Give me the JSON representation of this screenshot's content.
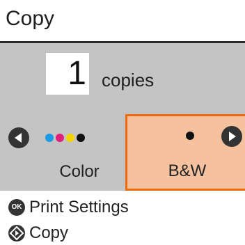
{
  "header": {
    "title": "Copy"
  },
  "copies": {
    "value": "1",
    "label": "copies"
  },
  "color_options": [
    {
      "label": "Color",
      "dots": [
        "#1a9be6",
        "#e0207a",
        "#f2d500",
        "#111111"
      ]
    },
    {
      "label": "B&W",
      "dots": [
        "#111111"
      ],
      "selected": true
    }
  ],
  "colors": {
    "accent_border": "#ed6a10",
    "selected_fill": "#f6c19e",
    "panel_bg": "#c4c4c4"
  },
  "footer": {
    "items": [
      {
        "icon": "ok-button-icon",
        "icon_text": "OK",
        "label": "Print Settings"
      },
      {
        "icon": "start-diamond-icon",
        "label": "Copy"
      }
    ]
  }
}
